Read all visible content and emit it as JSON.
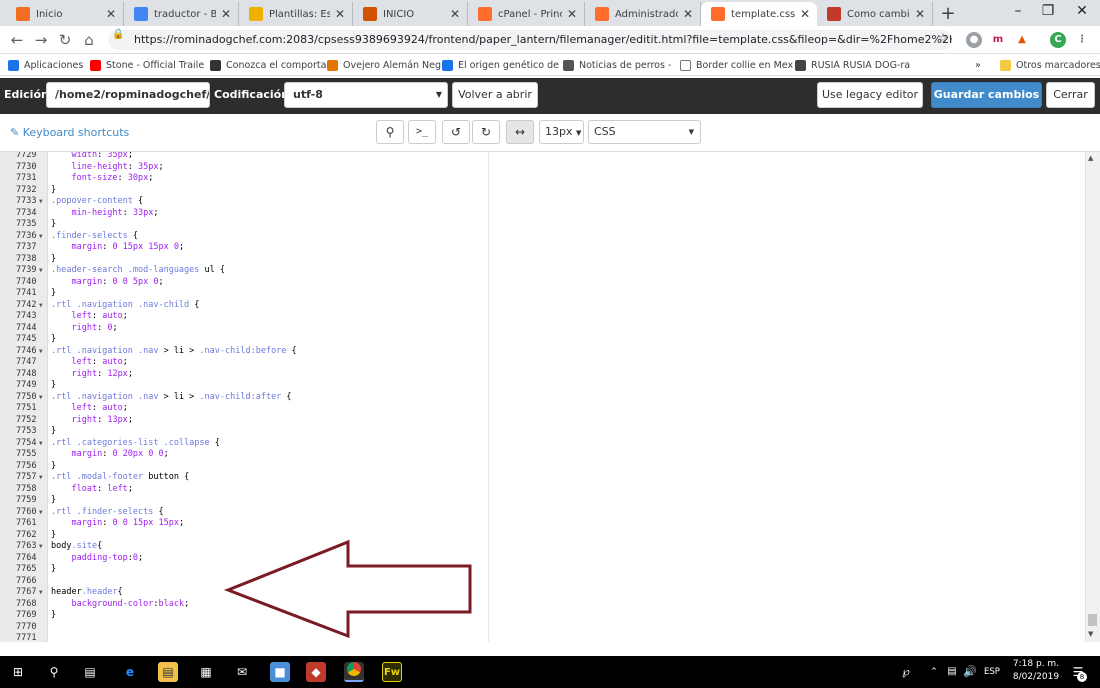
{
  "browser": {
    "tabs": [
      {
        "title": "Inicio",
        "color": "#f26e22",
        "active": false
      },
      {
        "title": "traductor - Busc",
        "color": "#4285f4",
        "active": false
      },
      {
        "title": "Plantillas: Estilos",
        "color": "#f0b000",
        "active": false
      },
      {
        "title": "INICIO",
        "color": "#d35400",
        "active": false
      },
      {
        "title": "cPanel - Principa",
        "color": "#ff6c2c",
        "active": false
      },
      {
        "title": "Administrador d",
        "color": "#ff6c2c",
        "active": false
      },
      {
        "title": "template.css - A",
        "color": "#ff6c2c",
        "active": true
      },
      {
        "title": "Como cambiar e",
        "color": "#c0392b",
        "active": false
      }
    ],
    "new_tab": "+",
    "url": "https://rominadogchef.com:2083/cpsess9389693924/frontend/paper_lantern/filemanager/editit.html?file=template.css&fileop=&dir=%2Fhome2%2Fropminadogchef...",
    "bookmarks": [
      {
        "label": "Aplicaciones",
        "color": "#1a73e8"
      },
      {
        "label": "Stone - Official Traile",
        "color": "#ff0000"
      },
      {
        "label": "Conozca el comporta",
        "color": "#333333"
      },
      {
        "label": "Ovejero Alemán Neg",
        "color": "#e37400"
      },
      {
        "label": "El origen genético de",
        "color": "#1a73e8"
      },
      {
        "label": "Noticias de perros - ",
        "color": "#555555"
      },
      {
        "label": "Border collie en Mex",
        "color": "#ffffff"
      },
      {
        "label": "RUSIA RUSIA DOG-ra",
        "color": "#444444"
      }
    ],
    "bookmarks_more": "»",
    "other_bookmarks": "Otros marcadores"
  },
  "editor_toolbar": {
    "edition_label": "Edición:",
    "path_value": "/home2/ropminadogchef/|",
    "encoding_label": "Codificación:",
    "encoding_value": "utf-8",
    "reopen_button": "Volver a abrir",
    "legacy_button": "Use legacy editor",
    "save_button": "Guardar cambios",
    "close_button": "Cerrar"
  },
  "secondary_toolbar": {
    "keyboard_shortcuts": "Keyboard shortcuts",
    "font_size": "13px",
    "mode": "CSS"
  },
  "code_lines": [
    {
      "n": "7729",
      "fold": false,
      "parts": [
        [
          "",
          "    "
        ],
        [
          "p",
          "width"
        ],
        [
          "",
          ": "
        ],
        [
          "v",
          "35px"
        ],
        [
          "",
          ";"
        ]
      ]
    },
    {
      "n": "7730",
      "fold": false,
      "parts": [
        [
          "",
          "    "
        ],
        [
          "p",
          "line-height"
        ],
        [
          "",
          ": "
        ],
        [
          "v",
          "35px"
        ],
        [
          "",
          ";"
        ]
      ]
    },
    {
      "n": "7731",
      "fold": false,
      "parts": [
        [
          "",
          "    "
        ],
        [
          "p",
          "font-size"
        ],
        [
          "",
          ": "
        ],
        [
          "v",
          "30px"
        ],
        [
          "",
          ";"
        ]
      ]
    },
    {
      "n": "7732",
      "fold": false,
      "parts": [
        [
          "",
          "}"
        ]
      ]
    },
    {
      "n": "7733",
      "fold": true,
      "parts": [
        [
          "s",
          ".popover-content"
        ],
        [
          "",
          " {"
        ]
      ]
    },
    {
      "n": "7734",
      "fold": false,
      "parts": [
        [
          "",
          "    "
        ],
        [
          "p",
          "min-height"
        ],
        [
          "",
          ": "
        ],
        [
          "v",
          "33px"
        ],
        [
          "",
          ";"
        ]
      ]
    },
    {
      "n": "7735",
      "fold": false,
      "parts": [
        [
          "",
          "}"
        ]
      ]
    },
    {
      "n": "7736",
      "fold": true,
      "parts": [
        [
          "s",
          ".finder-selects"
        ],
        [
          "",
          " {"
        ]
      ]
    },
    {
      "n": "7737",
      "fold": false,
      "parts": [
        [
          "",
          "    "
        ],
        [
          "p",
          "margin"
        ],
        [
          "",
          ": "
        ],
        [
          "v",
          "0 15px 15px 0"
        ],
        [
          "",
          ";"
        ]
      ]
    },
    {
      "n": "7738",
      "fold": false,
      "parts": [
        [
          "",
          "}"
        ]
      ]
    },
    {
      "n": "7739",
      "fold": true,
      "parts": [
        [
          "s",
          ".header-search .mod-languages"
        ],
        [
          "",
          " ul {"
        ]
      ]
    },
    {
      "n": "7740",
      "fold": false,
      "parts": [
        [
          "",
          "    "
        ],
        [
          "p",
          "margin"
        ],
        [
          "",
          ": "
        ],
        [
          "v",
          "0 0 5px 0"
        ],
        [
          "",
          ";"
        ]
      ]
    },
    {
      "n": "7741",
      "fold": false,
      "parts": [
        [
          "",
          "}"
        ]
      ]
    },
    {
      "n": "7742",
      "fold": true,
      "parts": [
        [
          "s",
          ".rtl .navigation .nav-child"
        ],
        [
          "",
          " {"
        ]
      ]
    },
    {
      "n": "7743",
      "fold": false,
      "parts": [
        [
          "",
          "    "
        ],
        [
          "p",
          "left"
        ],
        [
          "",
          ": "
        ],
        [
          "v",
          "auto"
        ],
        [
          "",
          ";"
        ]
      ]
    },
    {
      "n": "7744",
      "fold": false,
      "parts": [
        [
          "",
          "    "
        ],
        [
          "p",
          "right"
        ],
        [
          "",
          ": "
        ],
        [
          "v",
          "0"
        ],
        [
          "",
          ";"
        ]
      ]
    },
    {
      "n": "7745",
      "fold": false,
      "parts": [
        [
          "",
          "}"
        ]
      ]
    },
    {
      "n": "7746",
      "fold": true,
      "parts": [
        [
          "s",
          ".rtl .navigation .nav"
        ],
        [
          "",
          " > li > "
        ],
        [
          "s",
          ".nav-child:before"
        ],
        [
          "",
          " {"
        ]
      ]
    },
    {
      "n": "7747",
      "fold": false,
      "parts": [
        [
          "",
          "    "
        ],
        [
          "p",
          "left"
        ],
        [
          "",
          ": "
        ],
        [
          "v",
          "auto"
        ],
        [
          "",
          ";"
        ]
      ]
    },
    {
      "n": "7748",
      "fold": false,
      "parts": [
        [
          "",
          "    "
        ],
        [
          "p",
          "right"
        ],
        [
          "",
          ": "
        ],
        [
          "v",
          "12px"
        ],
        [
          "",
          ";"
        ]
      ]
    },
    {
      "n": "7749",
      "fold": false,
      "parts": [
        [
          "",
          "}"
        ]
      ]
    },
    {
      "n": "7750",
      "fold": true,
      "parts": [
        [
          "s",
          ".rtl .navigation .nav"
        ],
        [
          "",
          " > li > "
        ],
        [
          "s",
          ".nav-child:after"
        ],
        [
          "",
          " {"
        ]
      ]
    },
    {
      "n": "7751",
      "fold": false,
      "parts": [
        [
          "",
          "    "
        ],
        [
          "p",
          "left"
        ],
        [
          "",
          ": "
        ],
        [
          "v",
          "auto"
        ],
        [
          "",
          ";"
        ]
      ]
    },
    {
      "n": "7752",
      "fold": false,
      "parts": [
        [
          "",
          "    "
        ],
        [
          "p",
          "right"
        ],
        [
          "",
          ": "
        ],
        [
          "v",
          "13px"
        ],
        [
          "",
          ";"
        ]
      ]
    },
    {
      "n": "7753",
      "fold": false,
      "parts": [
        [
          "",
          "}"
        ]
      ]
    },
    {
      "n": "7754",
      "fold": true,
      "parts": [
        [
          "s",
          ".rtl .categories-list .collapse"
        ],
        [
          "",
          " {"
        ]
      ]
    },
    {
      "n": "7755",
      "fold": false,
      "parts": [
        [
          "",
          "    "
        ],
        [
          "p",
          "margin"
        ],
        [
          "",
          ": "
        ],
        [
          "v",
          "0 20px 0 0"
        ],
        [
          "",
          ";"
        ]
      ]
    },
    {
      "n": "7756",
      "fold": false,
      "parts": [
        [
          "",
          "}"
        ]
      ]
    },
    {
      "n": "7757",
      "fold": true,
      "parts": [
        [
          "s",
          ".rtl .modal-footer"
        ],
        [
          "",
          " button {"
        ]
      ]
    },
    {
      "n": "7758",
      "fold": false,
      "parts": [
        [
          "",
          "    "
        ],
        [
          "p",
          "float"
        ],
        [
          "",
          ": "
        ],
        [
          "v",
          "left"
        ],
        [
          "",
          ";"
        ]
      ]
    },
    {
      "n": "7759",
      "fold": false,
      "parts": [
        [
          "",
          "}"
        ]
      ]
    },
    {
      "n": "7760",
      "fold": true,
      "parts": [
        [
          "s",
          ".rtl .finder-selects"
        ],
        [
          "",
          " {"
        ]
      ]
    },
    {
      "n": "7761",
      "fold": false,
      "parts": [
        [
          "",
          "    "
        ],
        [
          "p",
          "margin"
        ],
        [
          "",
          ": "
        ],
        [
          "v",
          "0 0 15px 15px"
        ],
        [
          "",
          ";"
        ]
      ]
    },
    {
      "n": "7762",
      "fold": false,
      "parts": [
        [
          "",
          "}"
        ]
      ]
    },
    {
      "n": "7763",
      "fold": true,
      "parts": [
        [
          "",
          "body"
        ],
        [
          "s",
          ".site"
        ],
        [
          "",
          "{"
        ]
      ]
    },
    {
      "n": "7764",
      "fold": false,
      "parts": [
        [
          "",
          "    "
        ],
        [
          "p",
          "padding-top"
        ],
        [
          "",
          ":"
        ],
        [
          "v",
          "0"
        ],
        [
          "",
          ";"
        ]
      ]
    },
    {
      "n": "7765",
      "fold": false,
      "parts": [
        [
          "",
          "}"
        ]
      ]
    },
    {
      "n": "7766",
      "fold": false,
      "parts": [
        [
          "",
          ""
        ]
      ]
    },
    {
      "n": "7767",
      "fold": true,
      "parts": [
        [
          "",
          "header"
        ],
        [
          "s",
          ".header"
        ],
        [
          "",
          "{"
        ]
      ]
    },
    {
      "n": "7768",
      "fold": false,
      "parts": [
        [
          "",
          "    "
        ],
        [
          "p",
          "background-color"
        ],
        [
          "",
          ":"
        ],
        [
          "v",
          "black"
        ],
        [
          "",
          ";"
        ]
      ]
    },
    {
      "n": "7769",
      "fold": false,
      "parts": [
        [
          "",
          "}"
        ]
      ]
    },
    {
      "n": "7770",
      "fold": false,
      "parts": [
        [
          "",
          ""
        ]
      ]
    },
    {
      "n": "7771",
      "fold": false,
      "parts": [
        [
          "",
          ""
        ]
      ]
    }
  ],
  "annotation": {
    "color": "#7b1a24",
    "icon": "left-arrow"
  },
  "taskbar": {
    "lang": "ESP",
    "time": "7:18 p. m.",
    "date": "8/02/2019",
    "notifications": "8"
  }
}
